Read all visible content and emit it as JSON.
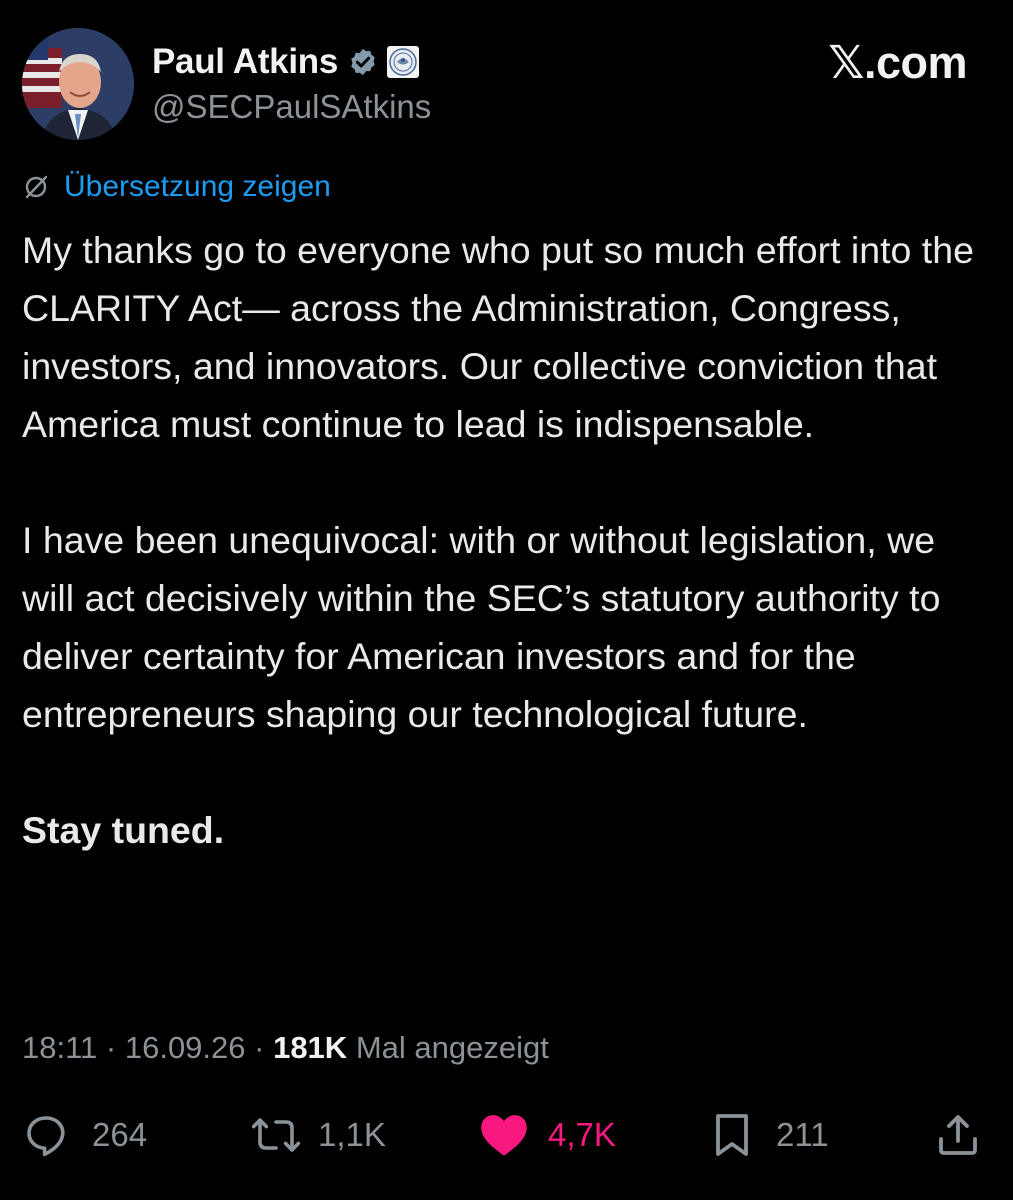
{
  "author": {
    "name": "Paul Atkins",
    "handle": "@SECPaulSAtkins"
  },
  "brand": {
    "label": ".com",
    "x_glyph": "𝕏"
  },
  "translate": {
    "label": "Übersetzung zeigen",
    "icon": "globe-off-icon"
  },
  "post": {
    "paragraph1": "My thanks go to everyone who put so much effort into the CLARITY Act— across the Administration, Congress, investors, and innovators. Our collective conviction that America must continue to lead is indispensable.",
    "paragraph2": "I have been unequivocal: with or without legislation, we will act decisively within the SEC’s statutory authority to deliver certainty for American investors and for the entrepreneurs shaping our technological future.",
    "paragraph3": "Stay tuned."
  },
  "meta": {
    "time": "18:11",
    "date": "16.09.26",
    "views": "181K",
    "views_label": "Mal angezeigt"
  },
  "actions": {
    "replies": "264",
    "reposts": "1,1K",
    "likes": "4,7K",
    "bookmarks": "211"
  },
  "colors": {
    "background": "#000000",
    "link": "#1d9bf0",
    "like": "#f91880",
    "verified": "#829aab",
    "muted": "#8b9298"
  }
}
